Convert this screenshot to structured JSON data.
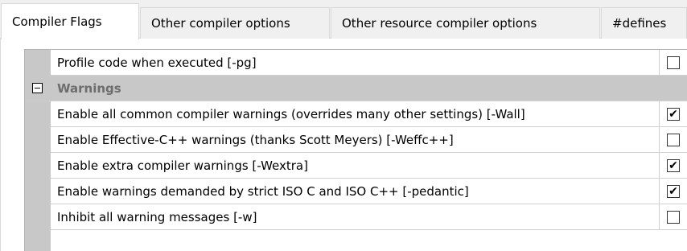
{
  "tabs": [
    {
      "label": "Compiler Flags",
      "active": true
    },
    {
      "label": "Other compiler options",
      "active": false
    },
    {
      "label": "Other resource compiler options",
      "active": false
    },
    {
      "label": "#defines",
      "active": false
    }
  ],
  "grid": {
    "rows": [
      {
        "kind": "option",
        "label": "Profile code when executed  [-pg]",
        "checked": false
      },
      {
        "kind": "category",
        "label": "Warnings",
        "expanded": true
      },
      {
        "kind": "option",
        "label": "Enable all common compiler warnings (overrides many other settings)  [-Wall]",
        "checked": true
      },
      {
        "kind": "option",
        "label": "Enable Effective-C++ warnings (thanks Scott Meyers)  [-Weffc++]",
        "checked": false
      },
      {
        "kind": "option",
        "label": "Enable extra compiler warnings  [-Wextra]",
        "checked": true
      },
      {
        "kind": "option",
        "label": "Enable warnings demanded by strict ISO C and ISO C++  [-pedantic]",
        "checked": true
      },
      {
        "kind": "option",
        "label": "Inhibit all warning messages  [-w]",
        "checked": false
      }
    ]
  },
  "check_mark": "✔",
  "colors": {
    "gutter": "#c8c8c8",
    "category_text": "#6d6d6d",
    "panel": "#ffffff"
  }
}
